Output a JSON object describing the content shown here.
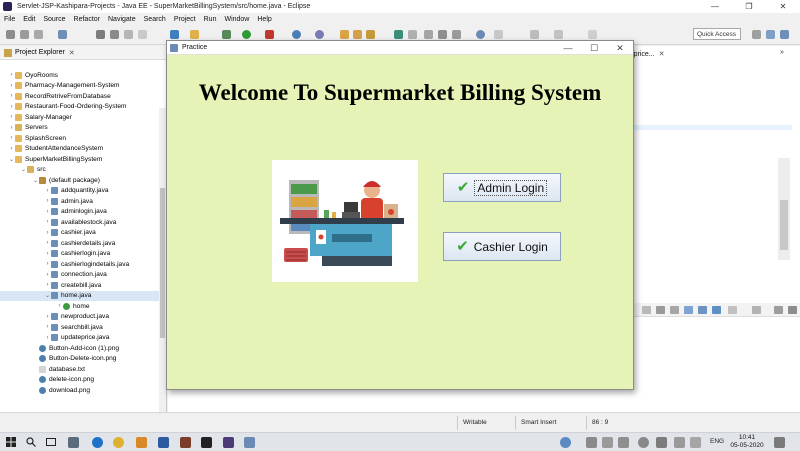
{
  "eclipse": {
    "title": "Servlet-JSP-Kashipara-Projects - Java EE - SuperMarketBillingSystem/src/home.java - Eclipse",
    "window_buttons": {
      "minimize": "—",
      "maximize": "❐",
      "close": "✕"
    },
    "menu": [
      "File",
      "Edit",
      "Source",
      "Refactor",
      "Navigate",
      "Search",
      "Project",
      "Run",
      "Window",
      "Help"
    ],
    "quick_access": "Quick Access",
    "explorer": {
      "title": "Project Explorer",
      "close": "✕",
      "items": [
        {
          "label": "OyoRooms",
          "icon": "project-icon",
          "arrow": "›"
        },
        {
          "label": "Pharmacy-Management-System",
          "icon": "project-icon",
          "arrow": "›"
        },
        {
          "label": "RecordRetriveFromDatabase",
          "icon": "project-icon",
          "arrow": "›"
        },
        {
          "label": "Restaurant-Food-Ordering-System",
          "icon": "project-icon",
          "arrow": "›"
        },
        {
          "label": "Salary-Manager",
          "icon": "project-icon",
          "arrow": "›"
        },
        {
          "label": "Servers",
          "icon": "folder-icon",
          "arrow": "›"
        },
        {
          "label": "SplashScreen",
          "icon": "project-icon",
          "arrow": "›"
        },
        {
          "label": "StudentAttendanceSystem",
          "icon": "project-icon",
          "arrow": "›"
        },
        {
          "label": "SuperMarketBillingSystem",
          "icon": "project-icon",
          "arrow": "⌄"
        },
        {
          "label": "src",
          "icon": "folder-icon",
          "arrow": "⌄"
        },
        {
          "label": "(default package)",
          "icon": "package-icon",
          "arrow": "⌄"
        },
        {
          "label": "addquantity.java",
          "icon": "java-file-icon",
          "arrow": "›"
        },
        {
          "label": "admin.java",
          "icon": "java-file-icon",
          "arrow": "›"
        },
        {
          "label": "adminlogin.java",
          "icon": "java-file-icon",
          "arrow": "›"
        },
        {
          "label": "availablestock.java",
          "icon": "java-file-icon",
          "arrow": "›"
        },
        {
          "label": "cashier.java",
          "icon": "java-file-icon",
          "arrow": "›"
        },
        {
          "label": "cashierdetails.java",
          "icon": "java-file-icon",
          "arrow": "›"
        },
        {
          "label": "cashierlogin.java",
          "icon": "java-file-icon",
          "arrow": "›"
        },
        {
          "label": "cashierlogindetails.java",
          "icon": "java-file-icon",
          "arrow": "›"
        },
        {
          "label": "connection.java",
          "icon": "java-file-icon",
          "arrow": "›"
        },
        {
          "label": "createbill.java",
          "icon": "java-file-icon",
          "arrow": "›"
        },
        {
          "label": "home.java",
          "icon": "java-file-icon",
          "arrow": "⌄",
          "selected": true
        },
        {
          "label": "home",
          "icon": "class-icon",
          "arrow": "›"
        },
        {
          "label": "newproduct.java",
          "icon": "java-file-icon",
          "arrow": "›"
        },
        {
          "label": "searchbill.java",
          "icon": "java-file-icon",
          "arrow": "›"
        },
        {
          "label": "updateprice.java",
          "icon": "java-file-icon",
          "arrow": "›"
        },
        {
          "label": "Button-Add-icon (1).png",
          "icon": "image-file-icon",
          "arrow": ""
        },
        {
          "label": "Button-Delete-icon.png",
          "icon": "image-file-icon",
          "arrow": ""
        },
        {
          "label": "database.txt",
          "icon": "text-file-icon",
          "arrow": ""
        },
        {
          "label": "delete-icon.png",
          "icon": "image-file-icon",
          "arrow": ""
        },
        {
          "label": "download.png",
          "icon": "image-file-icon",
          "arrow": ""
        }
      ]
    },
    "editor_tab": "dateprice...",
    "editor_tab_close": "✕",
    "tab_more": "»",
    "status": {
      "writable": "Writable",
      "insert_mode": "Smart Insert",
      "position": "86 : 9"
    }
  },
  "practice": {
    "title": "Practice",
    "buttons": {
      "minimize": "—",
      "maximize": "☐",
      "close": "✕"
    },
    "heading": "Welcome To Supermarket Billing System",
    "admin_login": "Admin Login",
    "cashier_login": "Cashier Login",
    "check_glyph": "✔"
  },
  "taskbar": {
    "language": "ENG",
    "time": "10:41",
    "date": "05-05-2020"
  },
  "colors": {
    "practice_bg": "#e5f4b6",
    "eclipse_chrome": "#f0f0f0",
    "check_green": "#3aa832"
  }
}
